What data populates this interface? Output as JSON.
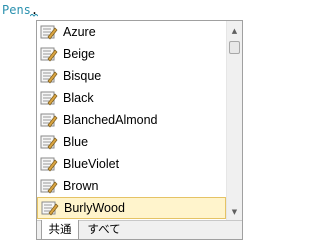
{
  "editor": {
    "code_identifier": "Pens",
    "code_dot": "."
  },
  "completion_list": {
    "items": [
      {
        "label": "Azure",
        "icon": "property-icon"
      },
      {
        "label": "Beige",
        "icon": "property-icon"
      },
      {
        "label": "Bisque",
        "icon": "property-icon"
      },
      {
        "label": "Black",
        "icon": "property-icon"
      },
      {
        "label": "BlanchedAlmond",
        "icon": "property-icon"
      },
      {
        "label": "Blue",
        "icon": "property-icon"
      },
      {
        "label": "BlueViolet",
        "icon": "property-icon"
      },
      {
        "label": "Brown",
        "icon": "property-icon"
      },
      {
        "label": "BurlyWood",
        "icon": "property-icon",
        "selected": true
      }
    ],
    "selected_label": "BurlyWood"
  },
  "tabs": [
    {
      "label": "共通",
      "active": true
    },
    {
      "label": "すべて",
      "active": false
    }
  ],
  "colors": {
    "identifier": "#2b91af",
    "selection_bg": "#fff4cc",
    "selection_border": "#e5c365"
  }
}
